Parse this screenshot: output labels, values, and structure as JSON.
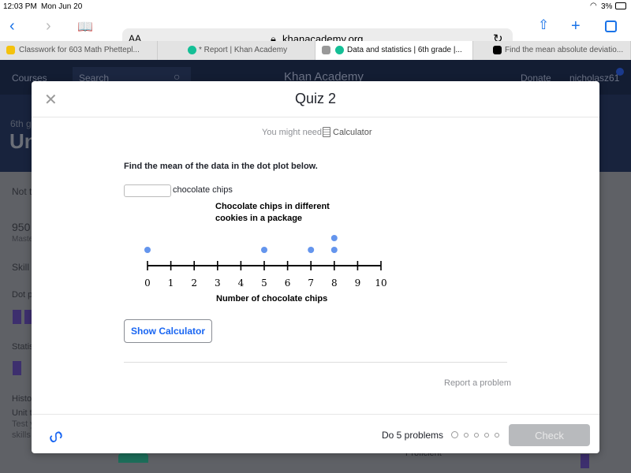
{
  "status": {
    "time": "12:03 PM",
    "date": "Mon Jun 20",
    "battery": "3%"
  },
  "browser": {
    "text_size": "AA",
    "url": "khanacademy.org",
    "icons": [
      "back-icon",
      "forward-icon",
      "bookmarks-icon",
      "reload-icon",
      "share-icon",
      "new-tab-icon",
      "tabs-icon"
    ]
  },
  "tabs": [
    {
      "label": "Classwork for 603 Math Phettepl...",
      "icon_color": "#f4c20d"
    },
    {
      "label": "* Report | Khan Academy",
      "icon_color": "#14bf96"
    },
    {
      "label": "Data and statistics | 6th grade |...",
      "icon_color": "#14bf96",
      "active": true
    },
    {
      "label": "Find the mean absolute deviatio...",
      "icon_color": "#000000"
    }
  ],
  "site": {
    "courses": "Courses",
    "search_placeholder": "Search",
    "logo": "Khan Academy",
    "donate": "Donate",
    "user": "nicholasz61"
  },
  "background": {
    "grade": "6th g",
    "unit": "Un",
    "not": "Not t",
    "points": "950",
    "mastery": "Maste",
    "skill": "Skill",
    "dot": "Dot p",
    "stats": "Statis",
    "hist": "Histo",
    "unit_test": "Unit t",
    "test": "Test y",
    "skills": "skills",
    "proficient": "Proficient"
  },
  "modal": {
    "title": "Quiz 2",
    "might_need": "You might need:",
    "calculator": "Calculator",
    "question": "Find the mean of the data in the dot plot below.",
    "answer_value": "",
    "unit": "chocolate chips",
    "show_calculator": "Show Calculator",
    "report": "Report a problem",
    "do_problems": "Do 5 problems",
    "check": "Check",
    "progress": {
      "total": 5,
      "current": 1
    }
  },
  "chart_data": {
    "type": "scatter",
    "subtype": "dot plot",
    "title": "Chocolate chips in different cookies in a package",
    "title_lines": [
      "Chocolate chips in different",
      "cookies in a package"
    ],
    "xlabel": "Number of chocolate chips",
    "xlim": [
      0,
      10
    ],
    "ticks": [
      "0",
      "1",
      "2",
      "3",
      "4",
      "5",
      "6",
      "7",
      "8",
      "9",
      "10"
    ],
    "values": [
      0,
      5,
      7,
      8,
      8
    ],
    "dot_color": "#6495ed"
  }
}
